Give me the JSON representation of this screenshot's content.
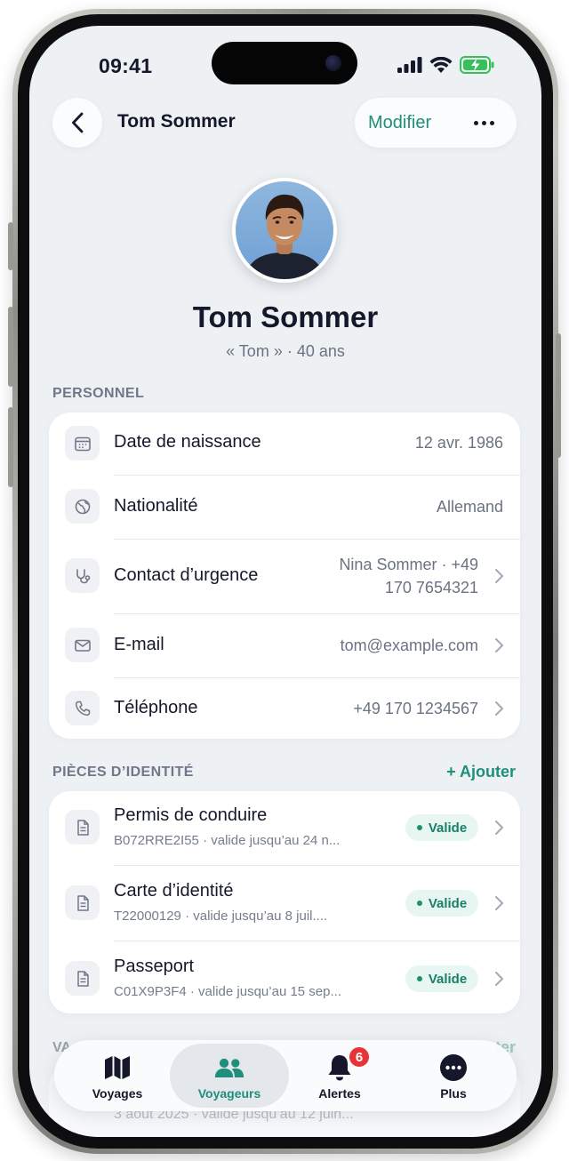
{
  "status": {
    "time": "09:41"
  },
  "header": {
    "title": "Tom Sommer",
    "edit_label": "Modifier"
  },
  "profile": {
    "name": "Tom Sommer",
    "subtitle": "« Tom » · 40 ans"
  },
  "personal": {
    "section_label": "PERSONNEL",
    "rows": [
      {
        "icon": "calendar-icon",
        "label": "Date de naissance",
        "value": "12 avr. 1986"
      },
      {
        "icon": "globe-icon",
        "label": "Nationalité",
        "value": "Allemand"
      },
      {
        "icon": "stethoscope-icon",
        "label": "Contact d’urgence",
        "value_line1": "Nina Sommer · +49",
        "value_line2": "170 7654321"
      },
      {
        "icon": "mail-icon",
        "label": "E-mail",
        "value": "tom@example.com"
      },
      {
        "icon": "phone-icon",
        "label": "Téléphone",
        "value": "+49 170 1234567"
      }
    ]
  },
  "documents": {
    "section_label": "PIÈCES D’IDENTITÉ",
    "add_label": "+ Ajouter",
    "items": [
      {
        "title": "Permis de conduire",
        "subtitle": "B072RRE2I55 · valide jusqu’au 24 n...",
        "status": "Valide"
      },
      {
        "title": "Carte d’identité",
        "subtitle": "T22000129 · valide jusqu’au 8 juil....",
        "status": "Valide"
      },
      {
        "title": "Passeport",
        "subtitle": "C01X9P3F4 · valide jusqu’au 15 sep...",
        "status": "Valide"
      }
    ]
  },
  "peek": {
    "section_label": "VA",
    "action_label": "ter",
    "subtitle": "3 août 2025 · valide jusqu’au 12 juin..."
  },
  "tabbar": {
    "tabs": [
      {
        "label": "Voyages",
        "icon": "map-icon"
      },
      {
        "label": "Voyageurs",
        "icon": "users-icon"
      },
      {
        "label": "Alertes",
        "icon": "bell-icon"
      },
      {
        "label": "Plus",
        "icon": "more-icon"
      }
    ],
    "active_tab": "Voyageurs",
    "alert_count": "6"
  },
  "colors": {
    "accent": "#1f8f7a",
    "background": "#eef1f4",
    "card": "#ffffff",
    "badge_bg": "#e8f6f1",
    "notification": "#e5353a"
  }
}
